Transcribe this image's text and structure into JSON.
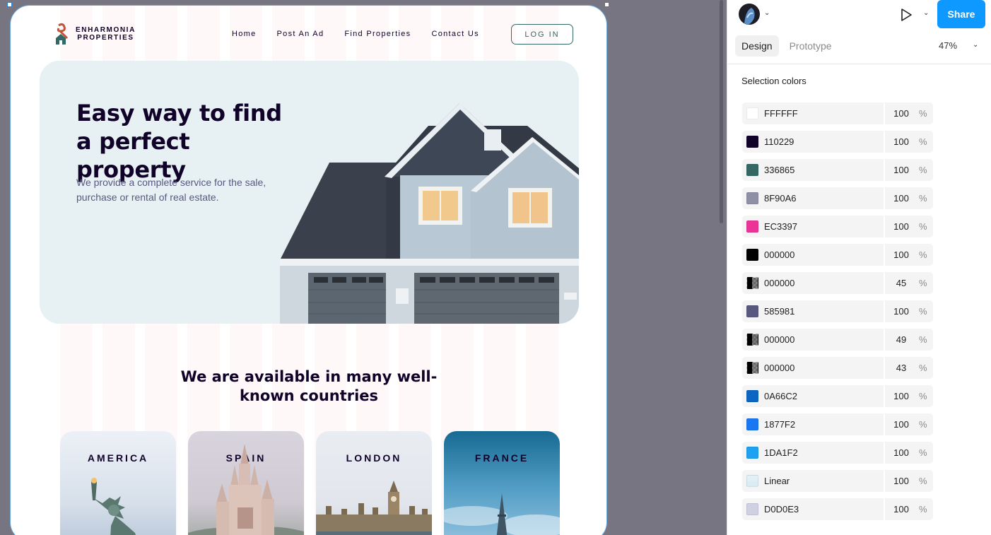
{
  "site": {
    "logo_line1": "ENHARMONIA",
    "logo_line2": "PROPERTIES",
    "nav": [
      "Home",
      "Post An Ad",
      "Find Properties",
      "Contact Us"
    ],
    "login": "LOG IN",
    "hero_title": "Easy way to find a perfect property",
    "hero_subtitle": "We provide a complete service for the sale, purchase or rental of real estate.",
    "countries_title": "We are available in many well-known countries",
    "countries": [
      "AMERICA",
      "SPAIN",
      "LONDON",
      "FRANCE"
    ]
  },
  "panel": {
    "share_label": "Share",
    "tabs": [
      "Design",
      "Prototype"
    ],
    "zoom": "47%",
    "section_title": "Selection colors",
    "percent_symbol": "%",
    "colors": [
      {
        "hex": "FFFFFF",
        "opacity": "100",
        "swatch": "#FFFFFF"
      },
      {
        "hex": "110229",
        "opacity": "100",
        "swatch": "#110229"
      },
      {
        "hex": "336865",
        "opacity": "100",
        "swatch": "#336865"
      },
      {
        "hex": "8F90A6",
        "opacity": "100",
        "swatch": "#8F90A6"
      },
      {
        "hex": "EC3397",
        "opacity": "100",
        "swatch": "#EC3397"
      },
      {
        "hex": "000000",
        "opacity": "100",
        "swatch": "#000000"
      },
      {
        "hex": "000000",
        "opacity": "45",
        "swatch": "#000000"
      },
      {
        "hex": "585981",
        "opacity": "100",
        "swatch": "#585981"
      },
      {
        "hex": "000000",
        "opacity": "49",
        "swatch": "#000000"
      },
      {
        "hex": "000000",
        "opacity": "43",
        "swatch": "#000000"
      },
      {
        "hex": "0A66C2",
        "opacity": "100",
        "swatch": "#0A66C2"
      },
      {
        "hex": "1877F2",
        "opacity": "100",
        "swatch": "#1877F2"
      },
      {
        "hex": "1DA1F2",
        "opacity": "100",
        "swatch": "#1DA1F2"
      },
      {
        "hex": "Linear",
        "opacity": "100",
        "swatch": "#D6EAF3"
      },
      {
        "hex": "D0D0E3",
        "opacity": "100",
        "swatch": "#D0D0E3"
      }
    ]
  }
}
